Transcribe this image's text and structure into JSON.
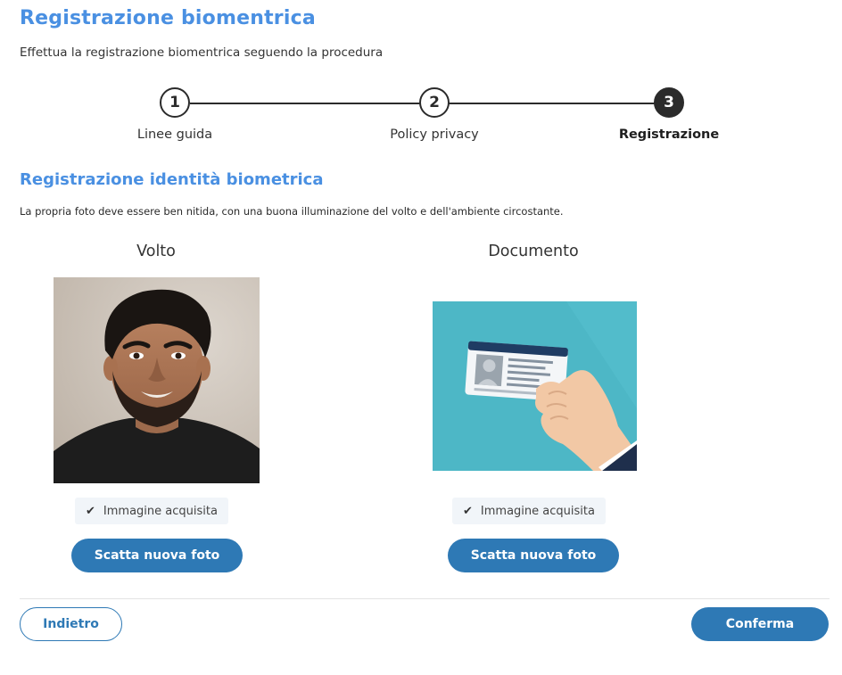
{
  "page": {
    "title": "Registrazione biomentrica",
    "subtitle": "Effettua la registrazione biomentrica seguendo la procedura"
  },
  "stepper": {
    "steps": [
      {
        "number": "1",
        "label": "Linee guida",
        "active": false
      },
      {
        "number": "2",
        "label": "Policy privacy",
        "active": false
      },
      {
        "number": "3",
        "label": "Registrazione",
        "active": true
      }
    ]
  },
  "section": {
    "title": "Registrazione identità biometrica",
    "description": "La propria foto deve essere ben nitida, con una buona illuminazione del volto e dell'ambiente circostante."
  },
  "face": {
    "title": "Volto",
    "status": "Immagine acquisita",
    "button": "Scatta nuova foto"
  },
  "document": {
    "title": "Documento",
    "status": "Immagine acquisita",
    "button": "Scatta nuova foto"
  },
  "footer": {
    "back": "Indietro",
    "confirm": "Conferma"
  },
  "colors": {
    "accent": "#4a90e2",
    "button": "#2e79b5",
    "doc_background": "#4db7c6"
  }
}
